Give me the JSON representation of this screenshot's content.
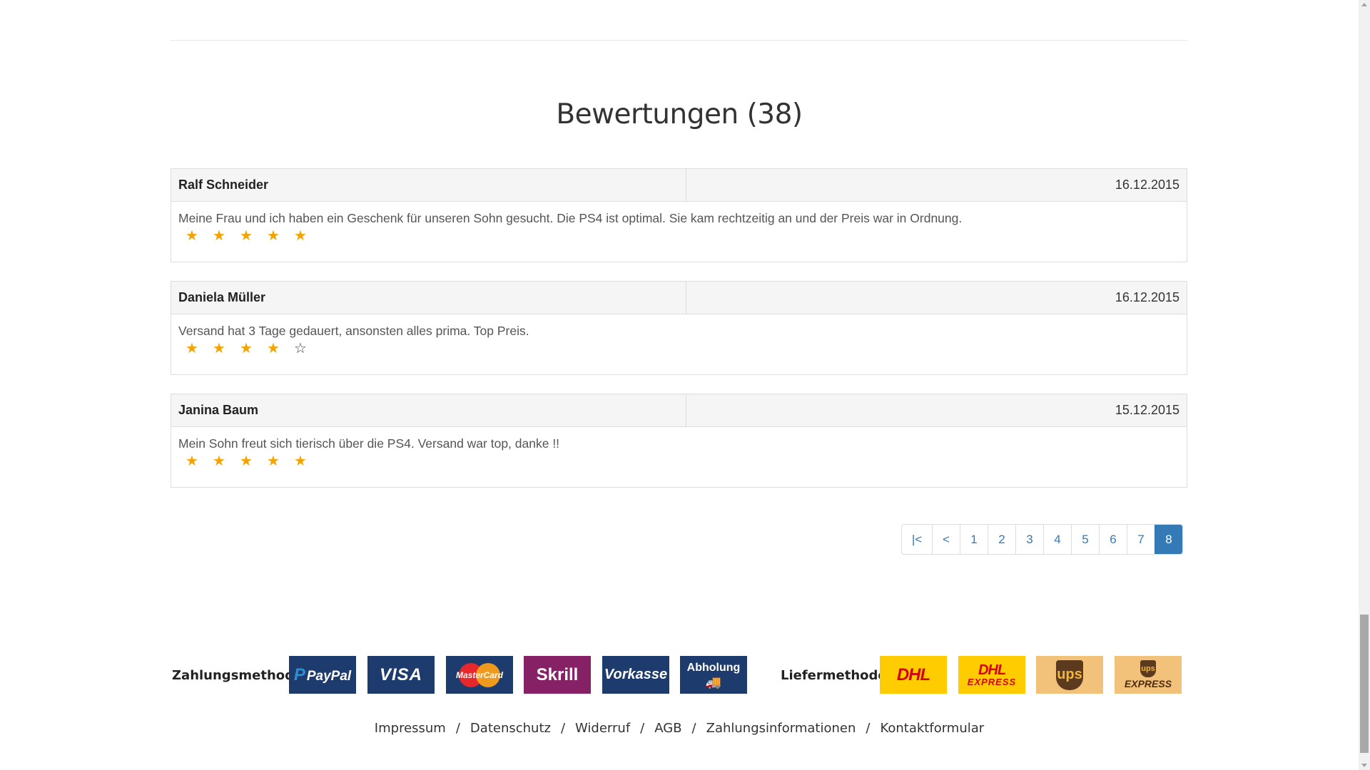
{
  "section": {
    "title": "Bewertungen (38)"
  },
  "reviews": [
    {
      "name": "Ralf Schneider",
      "date": "16.12.2015",
      "text": "Meine Frau und ich haben ein Geschenk für unseren Sohn gesucht. Die PS4 ist optimal. Sie kam rechtzeitig an und der Preis war in Ordnung.",
      "rating": 5,
      "rating_max": 5
    },
    {
      "name": "Daniela Müller",
      "date": "16.12.2015",
      "text": "Versand hat 3 Tage gedauert, ansonsten alles prima. Top Preis.",
      "rating": 4,
      "rating_max": 5
    },
    {
      "name": "Janina Baum",
      "date": "15.12.2015",
      "text": "Mein Sohn freut sich tierisch über die PS4. Versand war top, danke !!",
      "rating": 5,
      "rating_max": 5
    }
  ],
  "pagination": {
    "first_label": "|<",
    "prev_label": "<",
    "pages": [
      "1",
      "2",
      "3",
      "4",
      "5",
      "6",
      "7",
      "8"
    ],
    "active_page": "8"
  },
  "payment": {
    "label": "Zahlungsmethode :",
    "methods": [
      {
        "icon": "paypal-logo",
        "text_p": "P",
        "text": "PayPal"
      },
      {
        "icon": "visa-logo",
        "text": "VISA"
      },
      {
        "icon": "mastercard-logo",
        "text": "MasterCard"
      },
      {
        "icon": "skrill-logo",
        "text": "Skrill"
      },
      {
        "icon": "vorkasse-logo",
        "text": "Vorkasse"
      },
      {
        "icon": "abholung-logo",
        "text": "Abholung"
      }
    ]
  },
  "delivery": {
    "label": "Liefermethode :",
    "methods": [
      {
        "icon": "dhl-logo",
        "text": "DHL"
      },
      {
        "icon": "dhl-express-logo",
        "text": "DHL",
        "subtext": "EXPRESS"
      },
      {
        "icon": "ups-logo",
        "text": "ups"
      },
      {
        "icon": "ups-express-logo",
        "text": "ups",
        "subtext": "EXPRESS"
      }
    ]
  },
  "footer": {
    "links": [
      "Impressum",
      "Datenschutz",
      "Widerruf",
      "AGB",
      "Zahlungsinformationen",
      "Kontaktformular"
    ],
    "separator": "/"
  },
  "colors": {
    "accent": "#337ab7",
    "star_filled": "#f5a300",
    "star_empty": "#444444",
    "panel_head_bg": "#f5f5f5",
    "border": "#dddddd"
  },
  "icons": {
    "star_filled": "★",
    "star_empty": "☆"
  }
}
